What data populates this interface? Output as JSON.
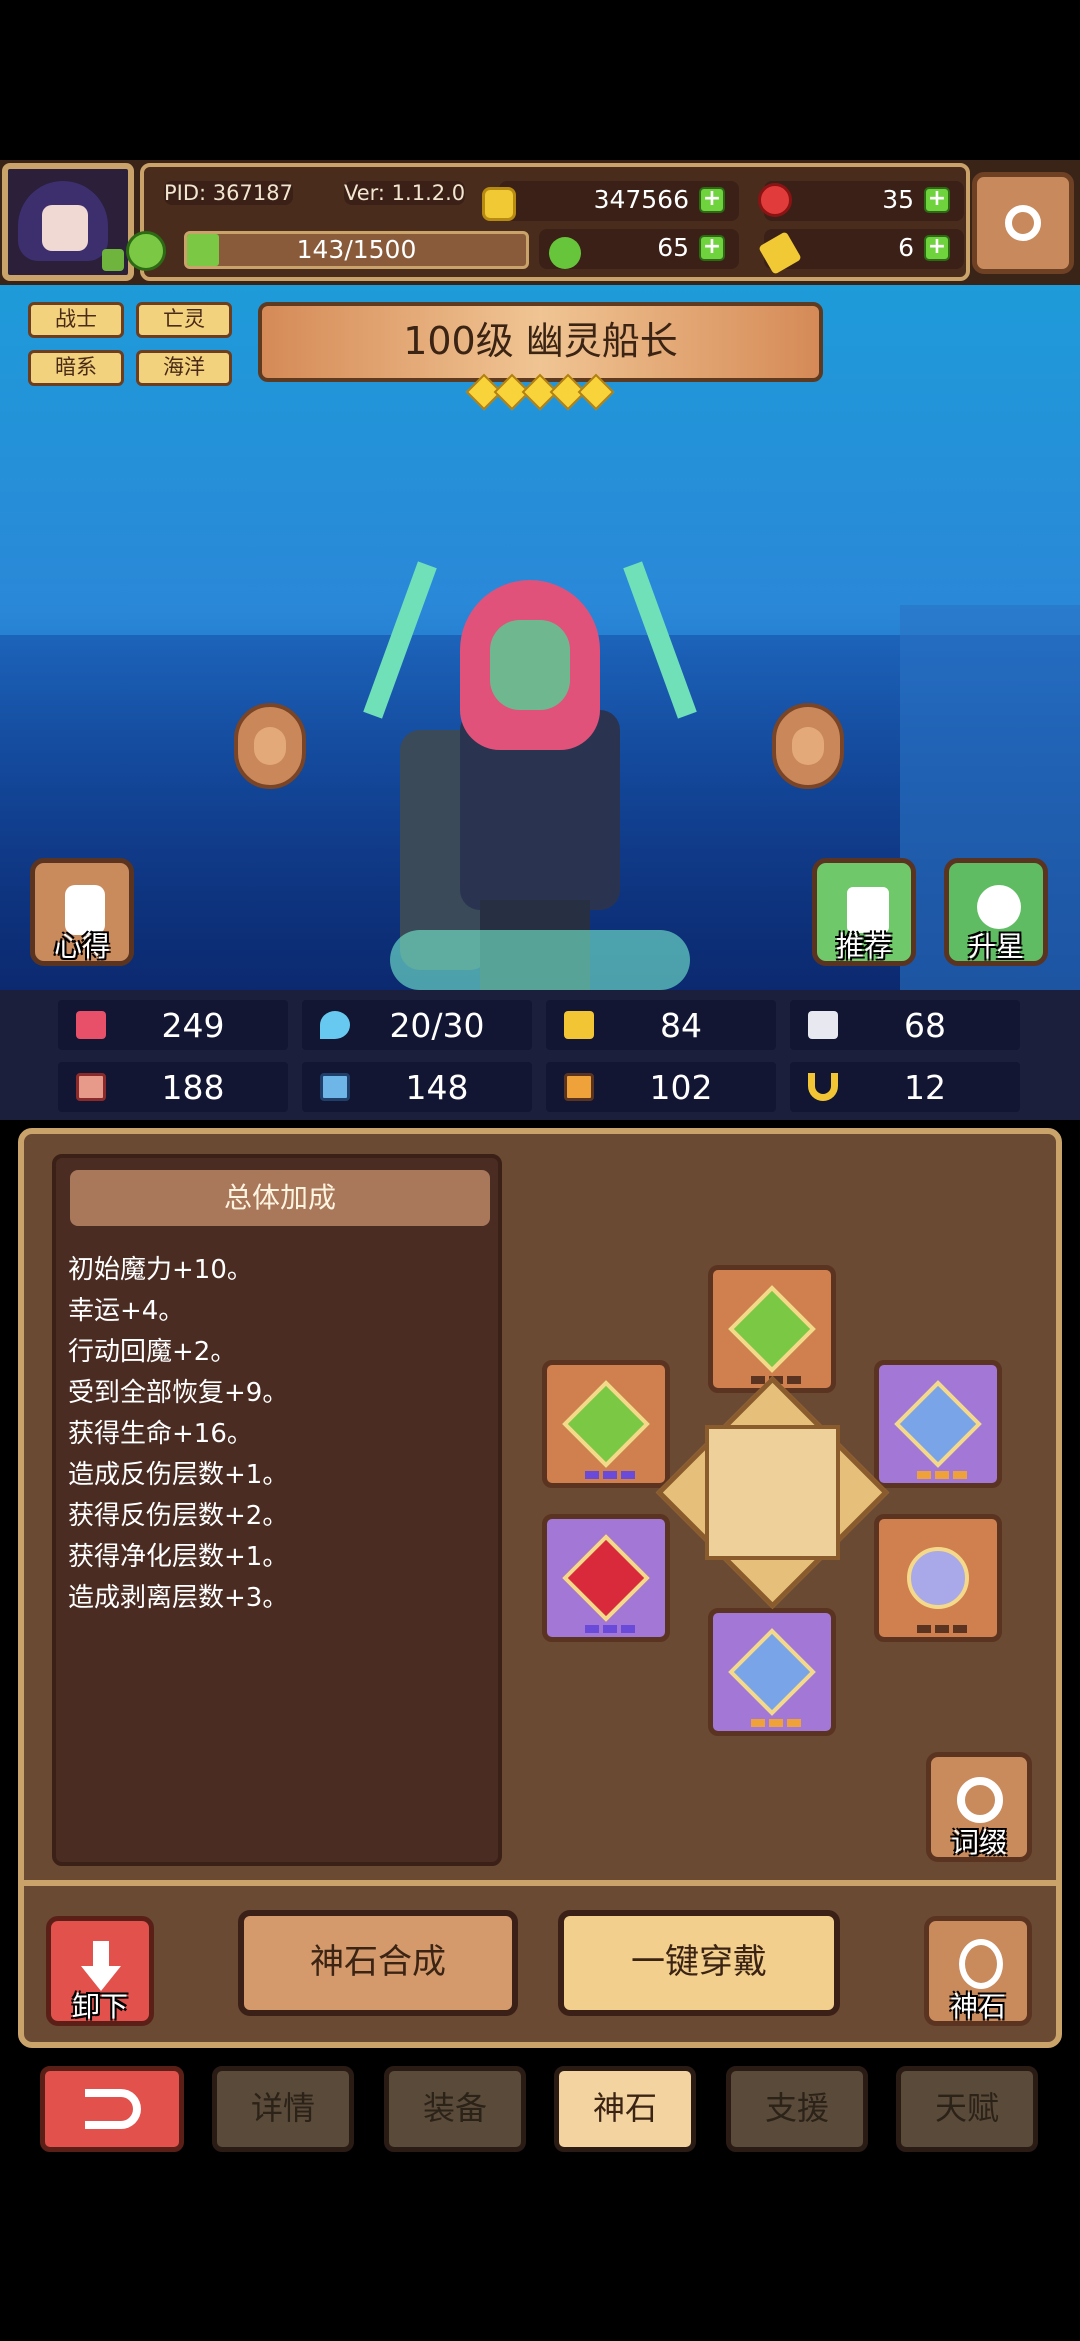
{
  "top": {
    "pid": "PID: 367187",
    "version": "Ver: 1.1.2.0",
    "gold": "347566",
    "gems": "35",
    "energy": "143/1500",
    "energy_fraction": 0.095,
    "clover": "65",
    "keys": "6"
  },
  "hero": {
    "tags": [
      "战士",
      "亡灵",
      "暗系",
      "海洋"
    ],
    "title": "100级 幽灵船长",
    "stars": 5
  },
  "scene_buttons": {
    "xinde": "心得",
    "tuijian": "推荐",
    "shengxing": "升星"
  },
  "stats": [
    {
      "icon": "heart-icon",
      "value": "249",
      "color": "#e8506a"
    },
    {
      "icon": "water-drop-icon",
      "value": "20/30",
      "color": "#67c8f0"
    },
    {
      "icon": "shield-icon",
      "value": "84",
      "color": "#f2c534"
    },
    {
      "icon": "wing-icon",
      "value": "68",
      "color": "#e8e8f0"
    },
    {
      "icon": "fist-icon",
      "value": "188",
      "color": "#e89a8a"
    },
    {
      "icon": "book-icon",
      "value": "148",
      "color": "#6fb6e8"
    },
    {
      "icon": "stairs-icon",
      "value": "102",
      "color": "#f0a23a"
    },
    {
      "icon": "horseshoe-icon",
      "value": "12",
      "color": "#f2c534"
    }
  ],
  "bonus": {
    "heading": "总体加成",
    "lines": [
      "初始魔力+10。",
      "幸运+4。",
      "行动回魔+2。",
      "受到全部恢复+9。",
      "获得生命+16。",
      "造成反伤层数+1。",
      "获得反伤层数+2。",
      "获得净化层数+1。",
      "造成剥离层数+3。"
    ]
  },
  "actions": {
    "search": "词缀",
    "unload": "卸下",
    "combine": "神石合成",
    "equip_all": "一键穿戴",
    "stone": "神石"
  },
  "tabs": {
    "details": "详情",
    "equipment": "装备",
    "stone": "神石",
    "support": "支援",
    "talent": "天赋"
  }
}
